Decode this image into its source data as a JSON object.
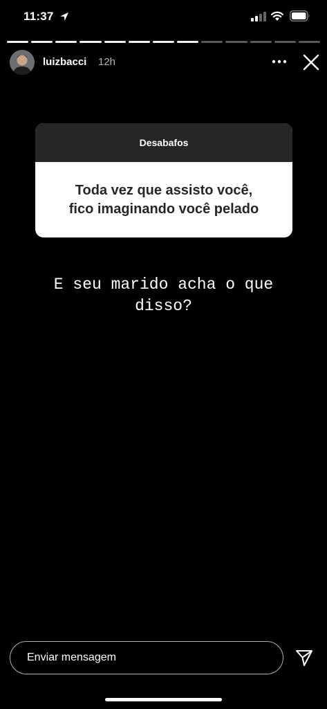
{
  "status_bar": {
    "time": "11:37",
    "icons": [
      "location-icon",
      "signal-icon",
      "wifi-icon",
      "battery-icon"
    ]
  },
  "story": {
    "progress_segments": 13,
    "progress_filled": 8,
    "user": {
      "username": "luizbacci",
      "time_ago": "12h"
    },
    "header_icons": [
      "more-icon",
      "close-icon"
    ]
  },
  "question": {
    "title": "Desabafos",
    "lines": [
      "Toda vez que assisto você,",
      "fico imaginando você pelado"
    ]
  },
  "answer": {
    "lines": [
      "E seu marido acha o que",
      "disso?"
    ]
  },
  "message": {
    "placeholder": "Enviar mensagem",
    "send_icon": "send-icon"
  },
  "colors": {
    "background": "#000000",
    "card_header": "#262626",
    "card_body": "#ffffff",
    "card_text": "#262626"
  }
}
